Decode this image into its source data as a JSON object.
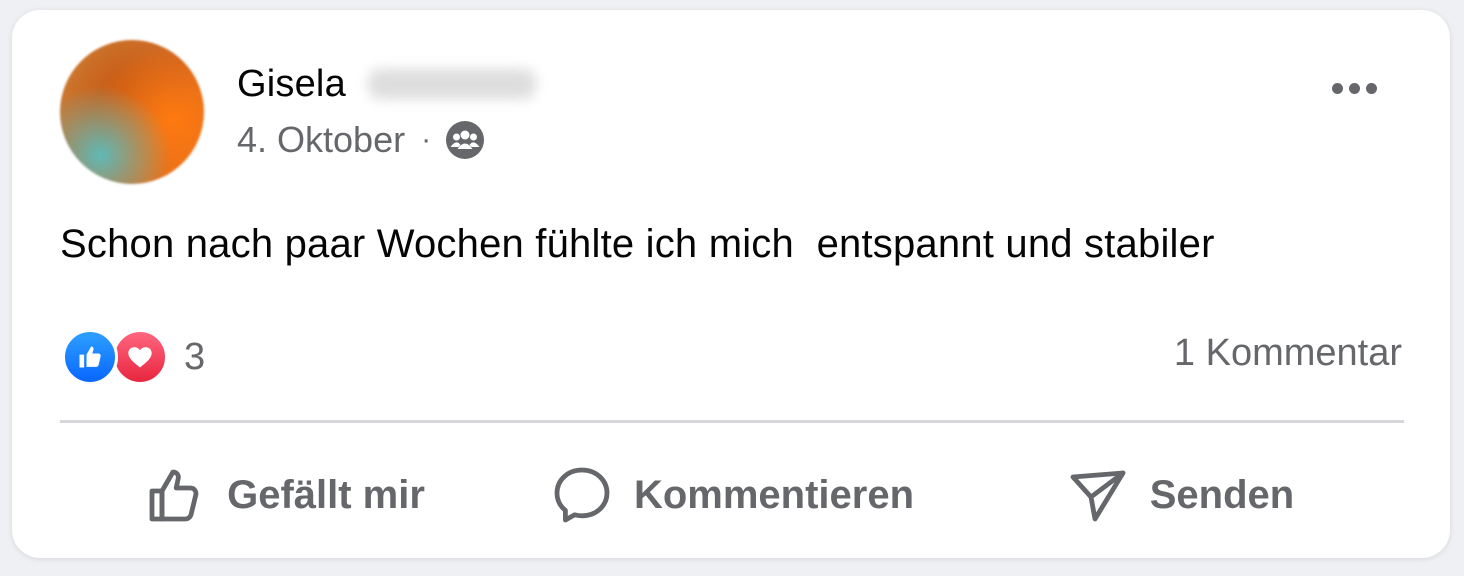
{
  "post": {
    "author_first_name": "Gisela",
    "date": "4. Oktober",
    "separator": "·",
    "audience_icon": "group-icon",
    "text": "Schon nach paar Wochen fühlte ich mich  entspannt und stabiler"
  },
  "reactions": {
    "icons": [
      "like-icon",
      "love-icon"
    ],
    "count": "3",
    "comments_label": "1 Kommentar"
  },
  "actions": {
    "like_label": "Gefällt mir",
    "comment_label": "Kommentieren",
    "share_label": "Senden"
  },
  "colors": {
    "text_primary": "#050505",
    "text_secondary": "#65676b",
    "like_blue": "#0866ff",
    "love_red": "#e8253e"
  }
}
